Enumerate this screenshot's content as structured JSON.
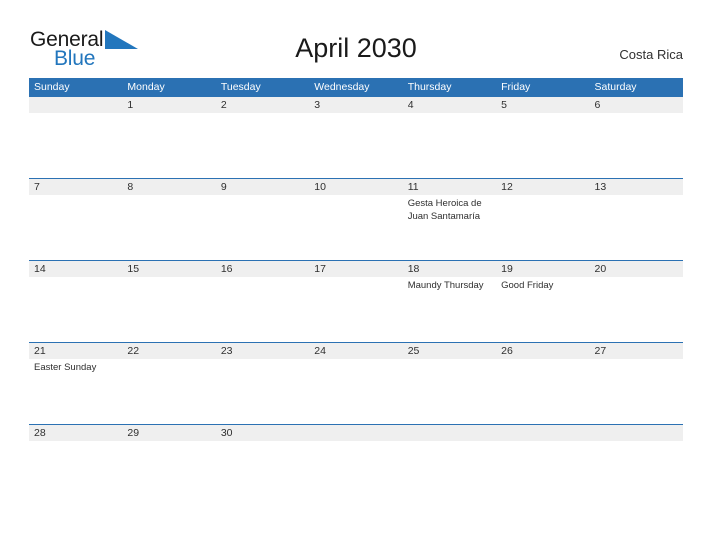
{
  "brand": {
    "line1": "General",
    "line2": "Blue",
    "flag_icon": "blue-triangle-flag",
    "flag_color": "#2276bd"
  },
  "header": {
    "title": "April 2030",
    "region": "Costa Rica"
  },
  "theme": {
    "header_blue": "#2b71b3",
    "row_band_gray": "#efefef",
    "text_dark": "#2f2f2f",
    "brand_blue": "#2276bd",
    "page_background": "#ffffff"
  },
  "calendar": {
    "weekdays": [
      "Sunday",
      "Monday",
      "Tuesday",
      "Wednesday",
      "Thursday",
      "Friday",
      "Saturday"
    ],
    "weeks": [
      {
        "days": [
          {
            "num": "",
            "event": ""
          },
          {
            "num": "1",
            "event": ""
          },
          {
            "num": "2",
            "event": ""
          },
          {
            "num": "3",
            "event": ""
          },
          {
            "num": "4",
            "event": ""
          },
          {
            "num": "5",
            "event": ""
          },
          {
            "num": "6",
            "event": ""
          }
        ]
      },
      {
        "days": [
          {
            "num": "7",
            "event": ""
          },
          {
            "num": "8",
            "event": ""
          },
          {
            "num": "9",
            "event": ""
          },
          {
            "num": "10",
            "event": ""
          },
          {
            "num": "11",
            "event": "Gesta Heroica de Juan Santamaría"
          },
          {
            "num": "12",
            "event": ""
          },
          {
            "num": "13",
            "event": ""
          }
        ]
      },
      {
        "days": [
          {
            "num": "14",
            "event": ""
          },
          {
            "num": "15",
            "event": ""
          },
          {
            "num": "16",
            "event": ""
          },
          {
            "num": "17",
            "event": ""
          },
          {
            "num": "18",
            "event": "Maundy Thursday"
          },
          {
            "num": "19",
            "event": "Good Friday"
          },
          {
            "num": "20",
            "event": ""
          }
        ]
      },
      {
        "days": [
          {
            "num": "21",
            "event": "Easter Sunday"
          },
          {
            "num": "22",
            "event": ""
          },
          {
            "num": "23",
            "event": ""
          },
          {
            "num": "24",
            "event": ""
          },
          {
            "num": "25",
            "event": ""
          },
          {
            "num": "26",
            "event": ""
          },
          {
            "num": "27",
            "event": ""
          }
        ]
      },
      {
        "days": [
          {
            "num": "28",
            "event": ""
          },
          {
            "num": "29",
            "event": ""
          },
          {
            "num": "30",
            "event": ""
          },
          {
            "num": "",
            "event": ""
          },
          {
            "num": "",
            "event": ""
          },
          {
            "num": "",
            "event": ""
          },
          {
            "num": "",
            "event": ""
          }
        ]
      }
    ]
  }
}
